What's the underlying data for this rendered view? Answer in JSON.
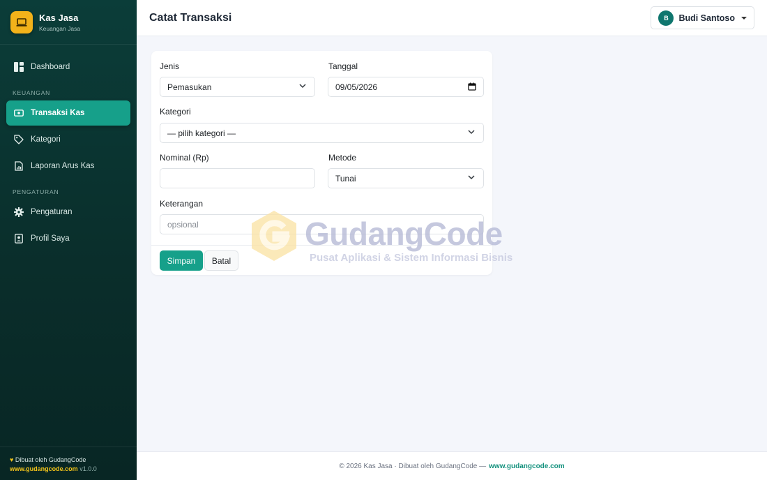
{
  "brand": {
    "title": "Kas Jasa",
    "subtitle": "Keuangan Jasa"
  },
  "nav": {
    "dashboard": "Dashboard",
    "section_keuangan": "KEUANGAN",
    "transaksi": "Transaksi Kas",
    "kategori": "Kategori",
    "laporan": "Laporan Arus Kas",
    "section_pengaturan": "PENGATURAN",
    "pengaturan": "Pengaturan",
    "profil": "Profil Saya"
  },
  "sidebar_footer": {
    "made_by": "Dibuat oleh GudangCode",
    "link": "www.gudangcode.com",
    "version": "v1.0.0"
  },
  "header": {
    "title": "Catat Transaksi",
    "user_initial": "B",
    "user_name": "Budi Santoso"
  },
  "form": {
    "jenis_label": "Jenis",
    "jenis_value": "Pemasukan",
    "tanggal_label": "Tanggal",
    "tanggal_value": "09/05/2026",
    "kategori_label": "Kategori",
    "kategori_value": "— pilih kategori —",
    "nominal_label": "Nominal (Rp)",
    "nominal_value": "",
    "metode_label": "Metode",
    "metode_value": "Tunai",
    "keterangan_label": "Keterangan",
    "keterangan_placeholder": "opsional",
    "save_label": "Simpan",
    "cancel_label": "Batal"
  },
  "watermark": {
    "title": "GudangCode",
    "subtitle": "Pusat Aplikasi & Sistem Informasi Bisnis"
  },
  "footer": {
    "text": "© 2026 Kas Jasa · Dibuat oleh GudangCode —",
    "link": "www.gudangcode.com"
  },
  "colors": {
    "accent": "#16a08a",
    "brand": "#f2b21a",
    "sidebar": "#0b3d39"
  },
  "icons": {
    "brand": "laptop-icon",
    "dashboard": "dashboard-grid-icon",
    "transaksi": "cash-icon",
    "kategori": "tag-icon",
    "laporan": "report-icon",
    "pengaturan": "gear-icon",
    "profil": "profile-card-icon"
  }
}
